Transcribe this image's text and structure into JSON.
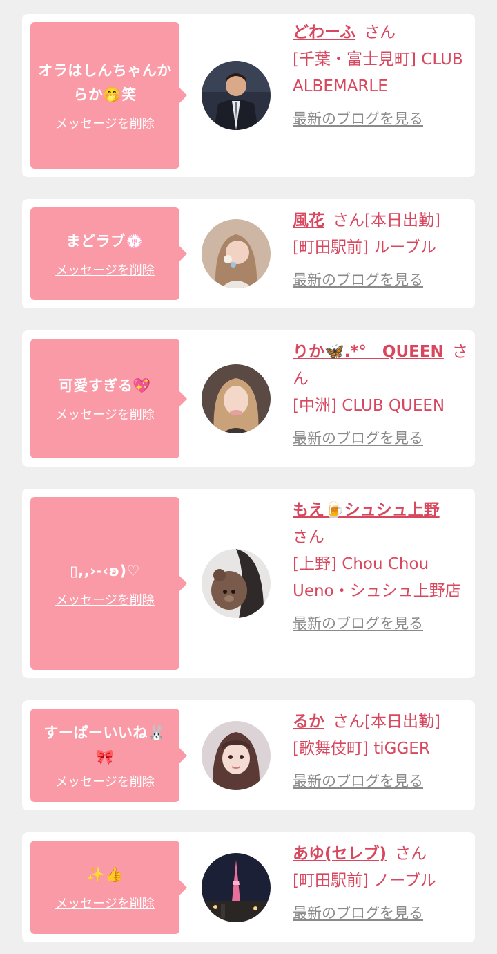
{
  "delete_label": "メッセージを削除",
  "blog_label": "最新のブログを見る",
  "honorific": "さん",
  "colors": {
    "bubble": "#f99aa6",
    "accent": "#d8475e",
    "muted": "#8a8a8a",
    "background": "#efefef"
  },
  "messages": [
    {
      "text": "オラはしんちゃんからか🤭笑",
      "user_name": "どわーふ",
      "honorific_suffix": "さん",
      "shop": "[千葉・富士見町] CLUB ALBEMARLE",
      "avatar_icon": "man-in-suit-avatar"
    },
    {
      "text": "まどラブ💮",
      "user_name": "風花",
      "honorific_suffix": "さん[本日出勤]",
      "shop": "[町田駅前] ルーブル",
      "avatar_icon": "woman-portrait-avatar"
    },
    {
      "text": "可愛すぎる💖",
      "user_name": "りか🦋.*°　QUEEN",
      "honorific_suffix": "さん",
      "shop": "[中洲] CLUB QUEEN",
      "avatar_icon": "woman-portrait-avatar"
    },
    {
      "text": "▯,,›-‹ʚ)♡",
      "user_name": "もえ🍺シュシュ上野",
      "honorific_suffix": "さん",
      "shop": "[上野] Chou Chou Ueno・シュシュ上野店",
      "avatar_icon": "woman-with-teddy-avatar"
    },
    {
      "text": "すーぱーいいね🐰🎀",
      "user_name": "るか",
      "honorific_suffix": "さん[本日出勤]",
      "shop": "[歌舞伎町] tiGGER",
      "avatar_icon": "woman-portrait-avatar"
    },
    {
      "text": "✨👍",
      "user_name": "あゆ(セレブ)",
      "honorific_suffix": "さん",
      "shop": "[町田駅前] ノーブル",
      "avatar_icon": "tower-night-avatar"
    }
  ]
}
